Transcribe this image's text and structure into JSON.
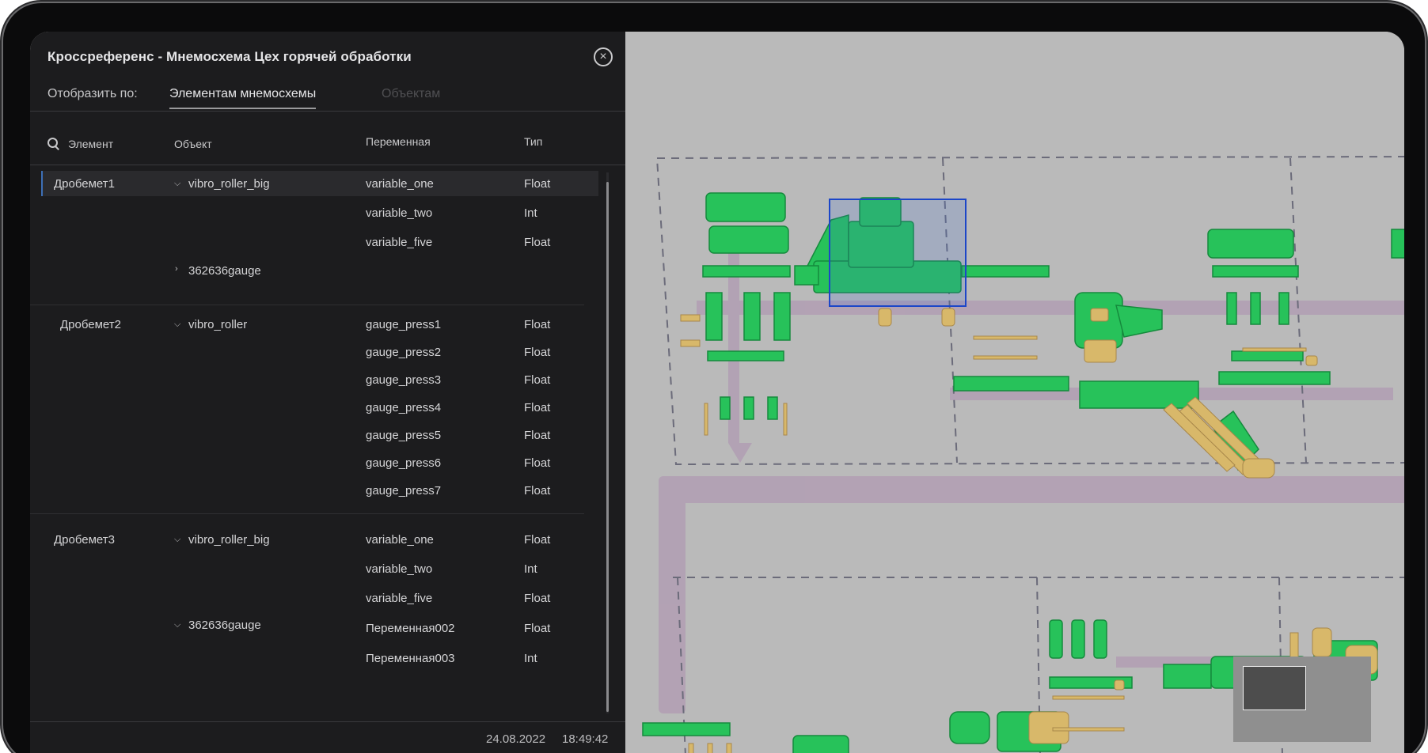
{
  "panel": {
    "title": "Кроссреференс - Мнемосхема Цех горячей обработки",
    "close_icon": "close-circle-icon",
    "display_label": "Отобразить по:",
    "tabs": [
      {
        "label": "Элементам мнемосхемы",
        "active": true
      },
      {
        "label": "Объектам",
        "active": false
      }
    ],
    "columns": {
      "element": "Элемент",
      "object": "Объект",
      "variable": "Переменная",
      "type": "Тип"
    },
    "groups": [
      {
        "element": "Дробемет1",
        "objects": [
          {
            "name": "vibro_roller_big",
            "expanded": true,
            "variables": [
              {
                "name": "variable_one",
                "type": "Float"
              },
              {
                "name": "variable_two",
                "type": "Int"
              },
              {
                "name": "variable_five",
                "type": "Float"
              }
            ]
          },
          {
            "name": "362636gauge",
            "expanded": false,
            "variables": []
          }
        ]
      },
      {
        "element": "Дробемет2",
        "objects": [
          {
            "name": "vibro_roller",
            "expanded": true,
            "variables": [
              {
                "name": "gauge_press1",
                "type": "Float"
              },
              {
                "name": "gauge_press2",
                "type": "Float"
              },
              {
                "name": "gauge_press3",
                "type": "Float"
              },
              {
                "name": "gauge_press4",
                "type": "Float"
              },
              {
                "name": "gauge_press5",
                "type": "Float"
              },
              {
                "name": "gauge_press6",
                "type": "Float"
              },
              {
                "name": "gauge_press7",
                "type": "Float"
              }
            ]
          }
        ]
      },
      {
        "element": "Дробемет3",
        "objects": [
          {
            "name": "vibro_roller_big",
            "expanded": true,
            "variables": [
              {
                "name": "variable_one",
                "type": "Float"
              },
              {
                "name": "variable_two",
                "type": "Int"
              },
              {
                "name": "variable_five",
                "type": "Float"
              }
            ]
          },
          {
            "name": "362636gauge",
            "expanded": true,
            "variables": [
              {
                "name": "Переменная002",
                "type": "Float"
              },
              {
                "name": "Переменная003",
                "type": "Int"
              }
            ]
          }
        ]
      }
    ],
    "footer": {
      "date": "24.08.2022",
      "time": "18:49:42"
    }
  },
  "scheme": {
    "colors": {
      "equipment": "#27c25a",
      "accent": "#d8b86a",
      "selection": "#1c46c8",
      "path": "#b09ab2"
    }
  }
}
